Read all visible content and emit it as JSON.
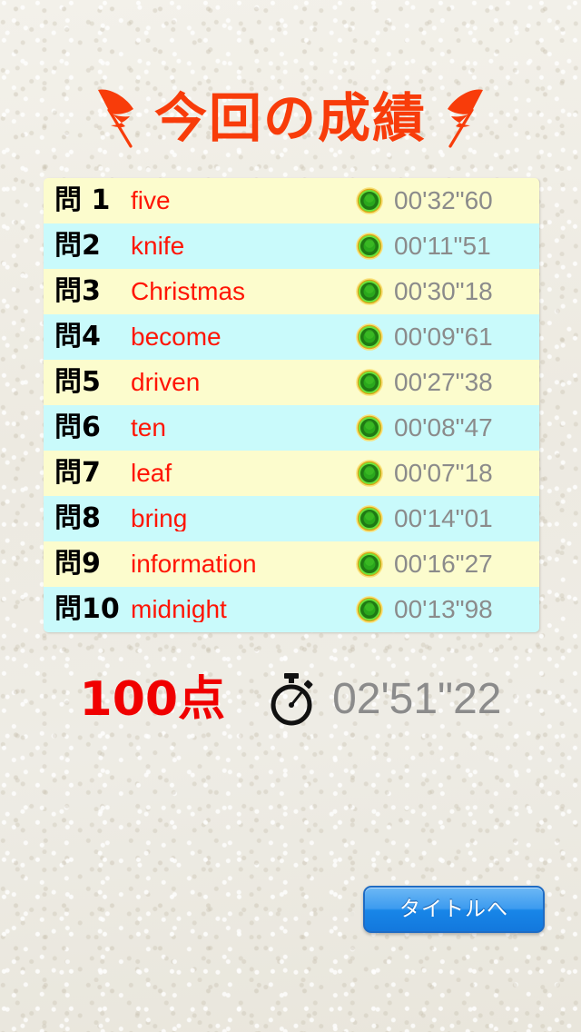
{
  "screen": {
    "title": "今回の成績",
    "title_color": "#f83c0a",
    "background_color": "#efece4"
  },
  "decorations": {
    "feather_left": "feather-quill-icon",
    "feather_right": "feather-quill-icon",
    "feather_color": "#f83c0a"
  },
  "results": {
    "row_colors": {
      "odd": "#fcfccd",
      "even": "#c9fafb"
    },
    "mark_icon": "green-circle-correct-icon",
    "rows": [
      {
        "question": "問 1",
        "word": "five",
        "mark": "correct",
        "time": "00'32\"60"
      },
      {
        "question": "問2",
        "word": "knife",
        "mark": "correct",
        "time": "00'11\"51"
      },
      {
        "question": "問3",
        "word": "Christmas",
        "mark": "correct",
        "time": "00'30\"18"
      },
      {
        "question": "問4",
        "word": "become",
        "mark": "correct",
        "time": "00'09\"61"
      },
      {
        "question": "問5",
        "word": "driven",
        "mark": "correct",
        "time": "00'27\"38"
      },
      {
        "question": "問6",
        "word": "ten",
        "mark": "correct",
        "time": "00'08\"47"
      },
      {
        "question": "問7",
        "word": "leaf",
        "mark": "correct",
        "time": "00'07\"18"
      },
      {
        "question": "問8",
        "word": "bring",
        "mark": "correct",
        "time": "00'14\"01"
      },
      {
        "question": "問9",
        "word": "information",
        "mark": "correct",
        "time": "00'16\"27"
      },
      {
        "question": "問10",
        "word": "midnight",
        "mark": "correct",
        "time": "00'13\"98"
      }
    ]
  },
  "summary": {
    "score": "100点",
    "score_color": "#f00000",
    "stopwatch_icon": "stopwatch-icon",
    "total_time": "02'51\"22",
    "total_time_color": "#8b8b8b"
  },
  "buttons": {
    "to_title": "タイトルへ"
  }
}
